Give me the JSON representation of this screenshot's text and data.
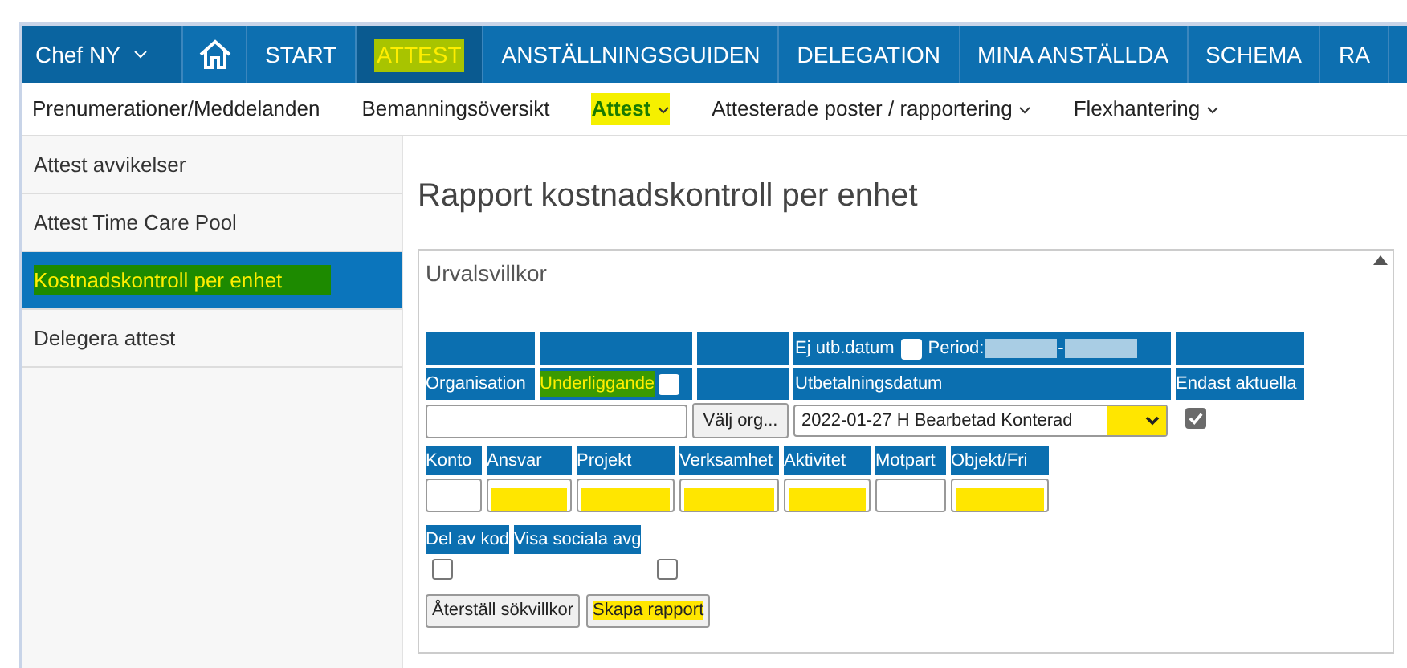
{
  "topnav": {
    "user_menu": "Chef NY",
    "items": [
      {
        "label": "START",
        "selected": false,
        "highlighted": false
      },
      {
        "label": "ATTEST",
        "selected": true,
        "highlighted": true
      },
      {
        "label": "ANSTÄLLNINGSGUIDEN",
        "selected": false,
        "highlighted": false
      },
      {
        "label": "DELEGATION",
        "selected": false,
        "highlighted": false
      },
      {
        "label": "MINA ANSTÄLLDA",
        "selected": false,
        "highlighted": false
      },
      {
        "label": "SCHEMA",
        "selected": false,
        "highlighted": false
      },
      {
        "label": "RA",
        "selected": false,
        "highlighted": false
      }
    ]
  },
  "subnav": [
    {
      "label": "Prenumerationer/Meddelanden",
      "selected": false,
      "dropdown": false,
      "highlighted": false
    },
    {
      "label": "Bemanningsöversikt",
      "selected": false,
      "dropdown": false,
      "highlighted": false
    },
    {
      "label": "Attest",
      "selected": true,
      "dropdown": true,
      "highlighted": true
    },
    {
      "label": "Attesterade poster / rapportering",
      "selected": false,
      "dropdown": true,
      "highlighted": false
    },
    {
      "label": "Flexhantering",
      "selected": false,
      "dropdown": true,
      "highlighted": false
    }
  ],
  "sidebar": {
    "items": [
      {
        "label": "Attest avvikelser",
        "selected": false,
        "highlighted": false
      },
      {
        "label": "Attest Time Care Pool",
        "selected": false,
        "highlighted": false
      },
      {
        "label": "Kostnadskontroll per enhet",
        "selected": true,
        "highlighted": true
      },
      {
        "label": "Delegera attest",
        "selected": false,
        "highlighted": false
      }
    ]
  },
  "page_title": "Rapport kostnadskontroll per enhet",
  "panel": {
    "title": "Urvalsvillkor",
    "ej_utb_label": "Ej utb.datum",
    "ej_utb_checked": false,
    "period_label": "Period:",
    "period_separator": "-",
    "org_label": "Organisation",
    "underliggande_label": "Underliggande",
    "underliggande_checked": false,
    "underliggande_highlighted": true,
    "utbetalning_label": "Utbetalningsdatum",
    "endast_label": "Endast aktuella",
    "endast_checked": true,
    "valj_org_button": "Välj org...",
    "date_value": "2022-01-27 H Bearbetad Konterad",
    "date_highlighted": true,
    "code_fields": [
      {
        "label": "Konto",
        "highlighted": false
      },
      {
        "label": "Ansvar",
        "highlighted": true
      },
      {
        "label": "Projekt",
        "highlighted": true
      },
      {
        "label": "Verksamhet",
        "highlighted": true
      },
      {
        "label": "Aktivitet",
        "highlighted": true
      },
      {
        "label": "Motpart",
        "highlighted": false
      },
      {
        "label": "Objekt/Fri",
        "highlighted": true
      }
    ],
    "options": [
      {
        "label": "Del av kod",
        "checked": false
      },
      {
        "label": "Visa sociala avg",
        "checked": false
      }
    ],
    "buttons": [
      {
        "label": "Återställ sökvillkor",
        "highlighted": false
      },
      {
        "label": "Skapa rapport",
        "highlighted": true
      }
    ]
  }
}
